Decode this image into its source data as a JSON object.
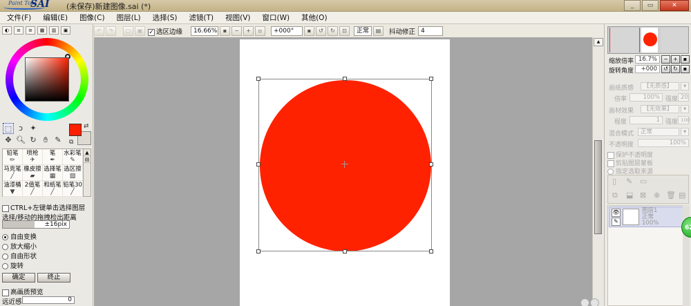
{
  "window": {
    "logo_small": "Paint Tool",
    "logo_big": "SAI",
    "title": "(未保存)新建图像.sai (*)",
    "buttons": [
      "_",
      "▭",
      "✕"
    ]
  },
  "menu": [
    "文件(F)",
    "编辑(E)",
    "图像(C)",
    "图层(L)",
    "选择(S)",
    "滤镜(T)",
    "视图(V)",
    "窗口(W)",
    "其他(O)"
  ],
  "toolbar": {
    "selection_edge_label": "选区边缘",
    "selection_edge_checked": true,
    "zoom": "16.66%",
    "rotation": "+000°",
    "blend": "正常",
    "stabilizer_label": "抖动修正",
    "stabilizer_value": "4"
  },
  "left": {
    "brushes": [
      {
        "label": "铅笔",
        "icon": "pencil-icon"
      },
      {
        "label": "喷枪",
        "icon": "airbrush-icon"
      },
      {
        "label": "笔",
        "icon": "pen-icon"
      },
      {
        "label": "水彩笔",
        "icon": "watercolor-icon"
      },
      {
        "label": "马克笔",
        "icon": "marker-icon"
      },
      {
        "label": "橡皮擦",
        "icon": "eraser-icon"
      },
      {
        "label": "选择笔",
        "icon": "select-pen-icon"
      },
      {
        "label": "选区擦",
        "icon": "select-eraser-icon"
      },
      {
        "label": "油漆桶",
        "icon": "bucket-icon"
      },
      {
        "label": "2值笔",
        "icon": "binary-pen-icon"
      },
      {
        "label": "和纸笔",
        "icon": "washi-pen-icon"
      },
      {
        "label": "铅笔30",
        "icon": "pencil30-icon"
      }
    ],
    "ctrl_click_label": "CTRL+左键单击选择图层",
    "drag_threshold_label": "选择/移动的拖拽检出距离",
    "drag_threshold_value": "±16pix",
    "transform_modes": [
      {
        "label": "自由变换",
        "selected": true
      },
      {
        "label": "放大缩小",
        "selected": false
      },
      {
        "label": "自由形状",
        "selected": false
      },
      {
        "label": "旋转",
        "selected": false
      }
    ],
    "ok_button": "确定",
    "cancel_button": "终止",
    "hq_preview_label": "高画质预览",
    "distance_label": "远近感",
    "distance_value": "0"
  },
  "right": {
    "zoom_label": "缩放倍率",
    "zoom_value": "16.7%",
    "rotate_label": "旋转角度",
    "rotate_value": "+000",
    "paper_texture_label": "画纸质感",
    "paper_texture_value": "【无质感】",
    "scale_label": "倍率",
    "scale_value": "100%",
    "strength_label": "强度",
    "strength_value": "20",
    "material_effect_label": "画材效果",
    "material_effect_value": "【无效果】",
    "degree_label": "程度",
    "degree_value": "1",
    "strength2_label": "强度",
    "strength2_value": "100",
    "blend_mode_label": "混合模式",
    "blend_mode_value": "正常",
    "opacity_label": "不透明度",
    "opacity_value": "100%",
    "protect_opacity_label": "保护不透明度",
    "clipping_label": "剪贴图层蒙板",
    "selection_source_label": "指定选取来源",
    "layer_name": "图层1",
    "layer_mode": "正常",
    "layer_opacity": "100%",
    "badge_text": "62"
  },
  "colors": {
    "foreground": "#ff1f00",
    "circle": "#ff2200",
    "canvas_bg": "#a6a6a6"
  }
}
